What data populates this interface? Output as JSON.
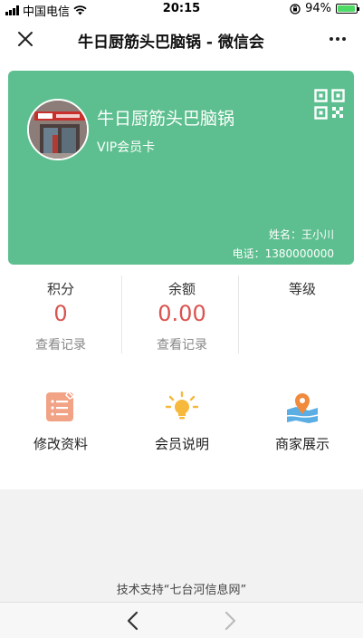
{
  "status_bar": {
    "carrier": "中国电信",
    "time": "20:15",
    "battery": "94%",
    "battery_level": 0.94
  },
  "nav": {
    "title": "牛日厨筋头巴脑锅 - 微信会"
  },
  "card": {
    "store_name": "牛日厨筋头巴脑锅",
    "level": "VIP会员卡",
    "holder": "姓名：王小川",
    "phone": "电话：1380000000",
    "background_color": "#5dbf8f"
  },
  "stats": [
    {
      "label": "积分",
      "value": "0",
      "link": "查看记录"
    },
    {
      "label": "余额",
      "value": "0.00",
      "link": "查看记录"
    },
    {
      "label": "等级",
      "value": "",
      "link": ""
    }
  ],
  "menu": [
    {
      "label": "修改资料",
      "icon": "edit-profile-icon"
    },
    {
      "label": "会员说明",
      "icon": "lightbulb-icon"
    },
    {
      "label": "商家展示",
      "icon": "map-location-icon"
    }
  ],
  "footer": {
    "support_text": "技术支持“七台河信息网”"
  }
}
